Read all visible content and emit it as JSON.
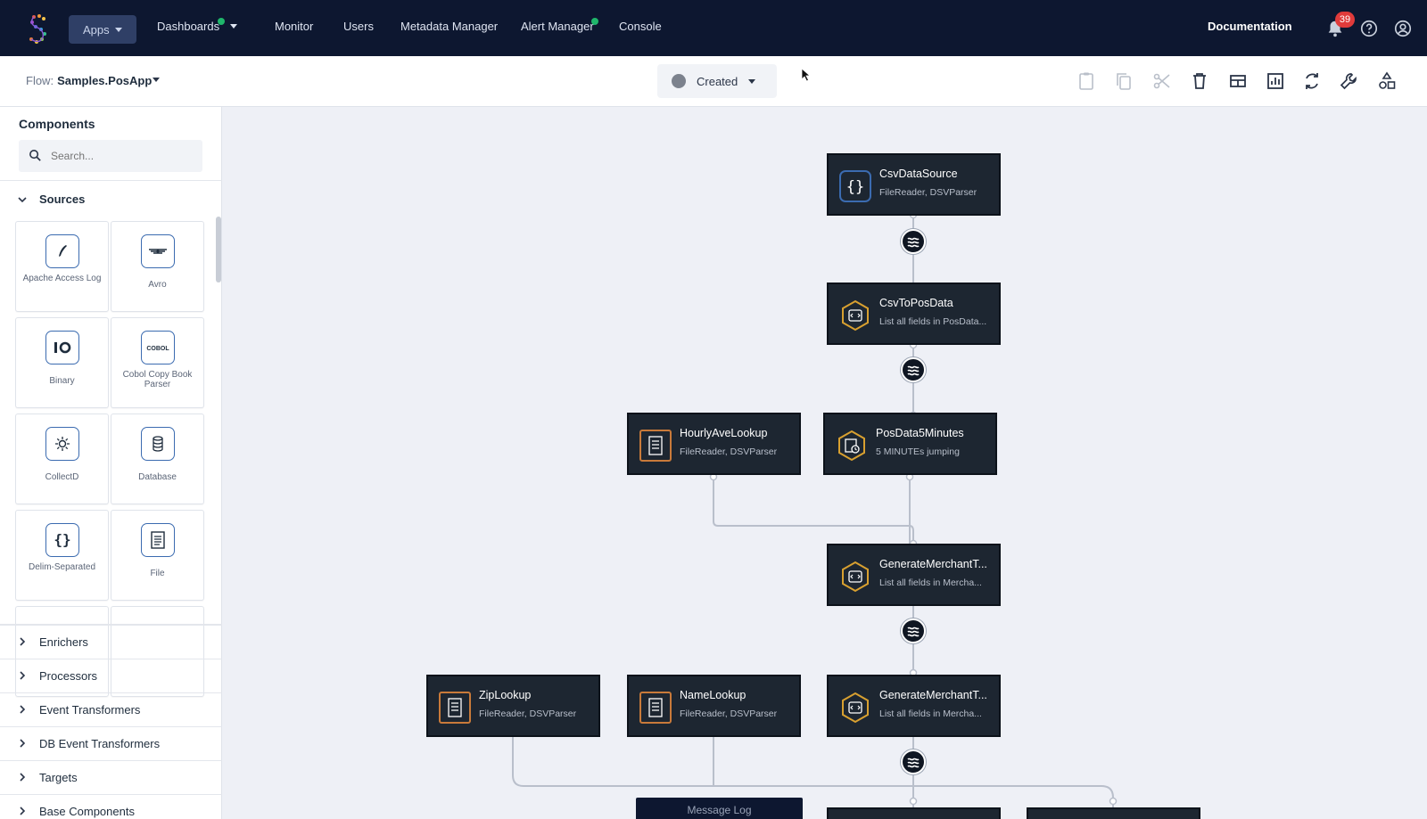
{
  "nav": {
    "apps": "Apps",
    "items": [
      "Dashboards",
      "Monitor",
      "Users",
      "Metadata Manager",
      "Alert Manager",
      "Console"
    ],
    "documentation": "Documentation",
    "notification_count": "39"
  },
  "toolbar": {
    "flow_prefix": "Flow:",
    "flow_name": "Samples.PosApp",
    "status": "Created"
  },
  "sidebar": {
    "title": "Components",
    "search_placeholder": "Search...",
    "sources_label": "Sources",
    "tiles": [
      "Apache Access Log",
      "Avro",
      "Binary",
      "Cobol Copy Book Parser",
      "CollectD",
      "Database",
      "Delim-Separated",
      "File"
    ],
    "sections": [
      "Enrichers",
      "Processors",
      "Event Transformers",
      "DB Event Transformers",
      "Targets",
      "Base Components"
    ]
  },
  "canvas": {
    "nodes": [
      {
        "title": "CsvDataSource",
        "sub": "FileReader, DSVParser"
      },
      {
        "title": "CsvToPosData",
        "sub": "List all fields in PosData..."
      },
      {
        "title": "HourlyAveLookup",
        "sub": "FileReader, DSVParser"
      },
      {
        "title": "PosData5Minutes",
        "sub": "5 MINUTEs jumping"
      },
      {
        "title": "GenerateMerchantT...",
        "sub": "List all fields in Mercha..."
      },
      {
        "title": "ZipLookup",
        "sub": "FileReader, DSVParser"
      },
      {
        "title": "NameLookup",
        "sub": "FileReader, DSVParser"
      },
      {
        "title": "GenerateMerchantT...",
        "sub": "List all fields in Mercha..."
      }
    ],
    "message_log": "Message Log"
  },
  "colors": {
    "nav_bg": "#0d1730",
    "node_bg": "#1d2631",
    "icon_blue": "#3b6bb0",
    "icon_orange": "#c97a3a",
    "icon_gold": "#d8a030",
    "badge_red": "#e03b3b",
    "status_green": "#1fb66b"
  }
}
